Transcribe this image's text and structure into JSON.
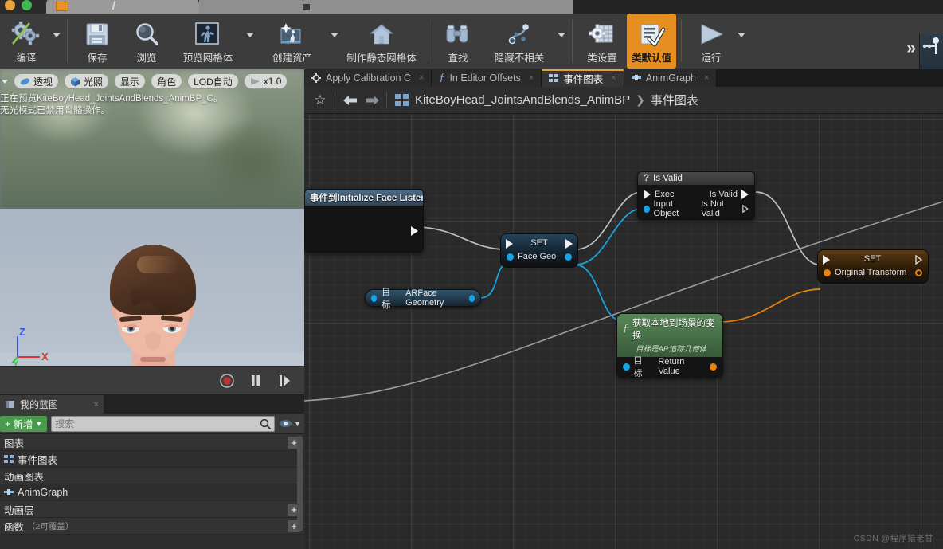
{
  "window": {
    "browser_tab_title": ""
  },
  "toolbar": {
    "items": [
      {
        "label": "编译",
        "icon": "compile-gears-icon",
        "dropdown": true,
        "active": false
      },
      {
        "label": "保存",
        "icon": "save-floppy-icon",
        "dropdown": false,
        "active": false
      },
      {
        "label": "浏览",
        "icon": "browse-magnifier-icon",
        "dropdown": false,
        "active": false
      },
      {
        "label": "预览网格体",
        "icon": "preview-mesh-icon",
        "dropdown": true,
        "active": false
      },
      {
        "label": "创建资产",
        "icon": "create-asset-icon",
        "dropdown": true,
        "active": false
      },
      {
        "label": "制作静态网格体",
        "icon": "make-static-mesh-icon",
        "dropdown": false,
        "active": false
      },
      {
        "label": "查找",
        "icon": "find-binoculars-icon",
        "dropdown": false,
        "active": false
      },
      {
        "label": "隐藏不相关",
        "icon": "hide-unrelated-icon",
        "dropdown": true,
        "active": false
      },
      {
        "label": "类设置",
        "icon": "class-settings-icon",
        "dropdown": false,
        "active": false
      },
      {
        "label": "类默认值",
        "icon": "class-defaults-icon",
        "dropdown": false,
        "active": true
      },
      {
        "label": "运行",
        "icon": "play-icon",
        "dropdown": true,
        "active": false
      }
    ],
    "overflow_label": "»"
  },
  "viewport": {
    "tools": [
      {
        "label": "透视",
        "icon": "perspective-icon"
      },
      {
        "label": "光照",
        "icon": "lit-cube-icon"
      },
      {
        "label": "显示",
        "icon": "show-icon"
      },
      {
        "label": "角色",
        "icon": "character-icon"
      },
      {
        "label": "LOD自动",
        "icon": "lod-icon"
      },
      {
        "label": "x1.0",
        "icon": "playrate-icon"
      }
    ],
    "note_line1": "正在预览KiteBoyHead_JointsAndBlends_AnimBP_C。",
    "note_line2": "无光模式已禁用骨骼操作。",
    "axis": {
      "x": "X",
      "y": "Y",
      "z": "Z"
    },
    "transport": [
      {
        "name": "record-button",
        "glyph": "●"
      },
      {
        "name": "pause-button",
        "glyph": "❚❚"
      },
      {
        "name": "step-button",
        "glyph": "❚▶"
      }
    ]
  },
  "my_blueprint": {
    "tab_label": "我的蓝图",
    "tab_close": "×",
    "add_label": "新增",
    "search_placeholder": "搜索",
    "sections": [
      {
        "name": "图表",
        "sub": "",
        "has_add": true,
        "items": [
          {
            "label": "事件图表",
            "icon": "graph-icon"
          }
        ]
      },
      {
        "name": "动画图表",
        "sub": "",
        "has_add": false,
        "items": [
          {
            "label": "AnimGraph",
            "icon": "animgraph-icon"
          }
        ]
      },
      {
        "name": "动画层",
        "sub": "",
        "has_add": true,
        "items": []
      },
      {
        "name": "函数",
        "sub": "（2可覆盖）",
        "has_add": true,
        "items": []
      }
    ]
  },
  "graph": {
    "tabs": [
      {
        "label": "Apply Calibration C",
        "icon": "gear-icon",
        "selected": false,
        "close": "×"
      },
      {
        "label": "In Editor Offsets",
        "icon": "function-icon",
        "selected": false,
        "close": "×"
      },
      {
        "label": "事件图表",
        "icon": "graph-icon",
        "selected": true,
        "close": "×"
      },
      {
        "label": "AnimGraph",
        "icon": "animgraph-icon",
        "selected": false,
        "close": "×"
      }
    ],
    "breadcrumb": {
      "star": "☆",
      "back": "back-arrow-icon",
      "forward": "forward-arrow-icon",
      "icon": "graph-icon",
      "root": "KiteBoyHead_JointsAndBlends_AnimBP",
      "separator": "❯",
      "leaf": "事件图表"
    },
    "nodes": {
      "event_node": {
        "title": "事件到Initialize Face Listeners"
      },
      "set_face_geo": {
        "title": "SET",
        "pin": "Face Geo"
      },
      "is_valid": {
        "title": "Is Valid",
        "title_icon": "?",
        "in_exec": "Exec",
        "in_object": "Input Object",
        "out_valid": "Is Valid",
        "out_not_valid": "Is Not Valid"
      },
      "arface_geometry": {
        "target": "目标",
        "value": "ARFace Geometry"
      },
      "get_local_to_world": {
        "title": "获取本地到场景的变换",
        "subtitle": "目标是AR追踪几何体",
        "in_target": "目标",
        "out_return": "Return Value"
      },
      "set_original_transform": {
        "title": "SET",
        "pin": "Original Transform"
      }
    }
  },
  "watermark": "CSDN @程序猿老甘",
  "colors": {
    "accent_orange": "#e78e21",
    "exec_wire": "#bfbfbf",
    "object_wire": "#14a5e8",
    "struct_wire": "#e8820c",
    "add_green": "#4a9a4e",
    "canvas_bg": "#2a2a2a",
    "toolbar_bg": "#3c3c3c"
  }
}
